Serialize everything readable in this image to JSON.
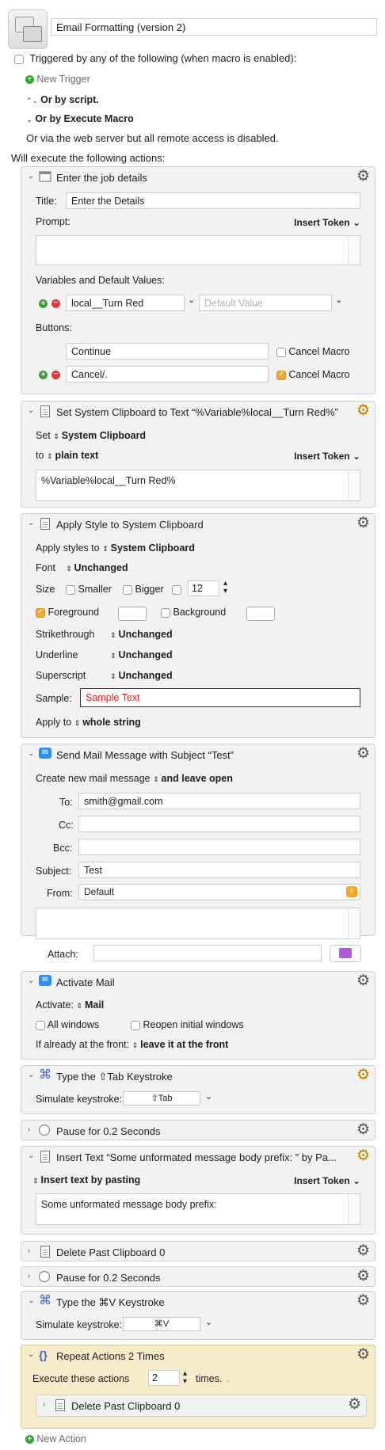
{
  "macro": {
    "name": "Email Formatting (version 2)",
    "trigger_text": "Triggered by any of the following (when macro is enabled):",
    "new_trigger": "New Trigger",
    "or_by_script": "Or by script.",
    "or_by_execute": "Or by Execute Macro",
    "web_server": "Or via the web server but all remote access is disabled.",
    "will_execute": "Will execute the following actions:",
    "new_action": "New Action"
  },
  "a1": {
    "title": "Enter the job details",
    "title_label": "Title:",
    "title_value": "Enter the Details",
    "prompt_label": "Prompt:",
    "insert_token": "Insert Token",
    "vars_label": "Variables and Default Values:",
    "var_name": "local__Turn Red",
    "var_default_placeholder": "Default Value",
    "buttons_label": "Buttons:",
    "btn1": "Continue",
    "btn1_cancel": "Cancel Macro",
    "btn2": "Cancel/.",
    "btn2_cancel": "Cancel Macro"
  },
  "a2": {
    "title": "Set System Clipboard to Text “%Variable%local__Turn Red%”",
    "set_label": "Set",
    "set_value": "System Clipboard",
    "to_label": "to",
    "to_value": "plain text",
    "insert_token": "Insert Token",
    "text": "%Variable%local__Turn Red%"
  },
  "a3": {
    "title": "Apply Style to System Clipboard",
    "apply_styles_to": "Apply styles to",
    "apply_styles_value": "System Clipboard",
    "font_label": "Font",
    "font_value": "Unchanged",
    "size_label": "Size",
    "smaller": "Smaller",
    "bigger": "Bigger",
    "size_value": "12",
    "foreground": "Foreground",
    "background": "Background",
    "strike_label": "Strikethrough",
    "strike_value": "Unchanged",
    "underline_label": "Underline",
    "underline_value": "Unchanged",
    "super_label": "Superscript",
    "super_value": "Unchanged",
    "sample_label": "Sample:",
    "sample_text": "Sample Text",
    "apply_to_label": "Apply to",
    "apply_to_value": "whole string"
  },
  "a4": {
    "title": "Send Mail Message with Subject “Test”",
    "create_label": "Create new mail message",
    "create_value": "and leave open",
    "to_label": "To:",
    "to_value": "smith@gmail.com",
    "cc_label": "Cc:",
    "bcc_label": "Bcc:",
    "subject_label": "Subject:",
    "subject_value": "Test",
    "from_label": "From:",
    "from_value": "Default",
    "attach_label": "Attach:"
  },
  "a5": {
    "title": "Activate Mail",
    "activate_label": "Activate:",
    "activate_value": "Mail",
    "all_windows": "All windows",
    "reopen": "Reopen initial windows",
    "front_label": "If already at the front:",
    "front_value": "leave it at the front"
  },
  "a6": {
    "title": "Type the ⇧Tab Keystroke",
    "sim_label": "Simulate keystroke:",
    "key": "⇧Tab"
  },
  "a7": {
    "title": "Pause for 0.2 Seconds"
  },
  "a8": {
    "title": "Insert Text “Some unformated message body prefix: ” by Pa...",
    "mode": "Insert text by pasting",
    "insert_token": "Insert Token",
    "text": "Some unformated message body prefix:"
  },
  "a9": {
    "title": "Delete Past Clipboard 0"
  },
  "a10": {
    "title": "Pause for 0.2 Seconds"
  },
  "a11": {
    "title": "Type the ⌘V Keystroke",
    "sim_label": "Simulate keystroke:",
    "key": "⌘V"
  },
  "a12": {
    "title": "Repeat Actions 2 Times",
    "execute_label": "Execute these actions",
    "times_value": "2",
    "times_label": "times.",
    "inner_title": "Delete Past Clipboard 0"
  },
  "colors": {
    "accent_orange": "#f0a830",
    "panel": "#f2f2f2",
    "repeat_panel": "#f7ecc9",
    "sample_red": "#e0201a"
  }
}
